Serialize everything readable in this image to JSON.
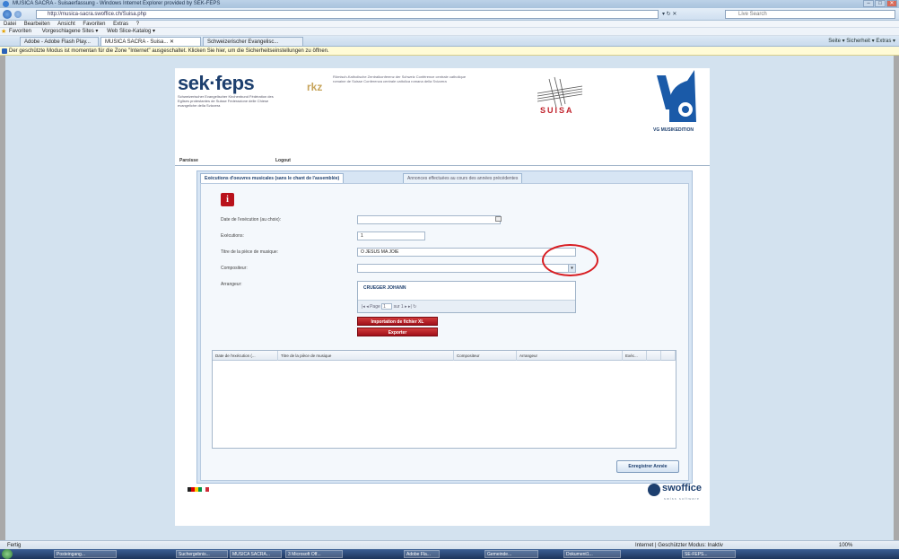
{
  "window": {
    "title": "MUSICA SACRA - Suisaerfassung - Windows Internet Explorer provided by SEK-FEPS",
    "min": "–",
    "max": "□",
    "close": "✕"
  },
  "address": {
    "url": "http://musica-sacra.swoffice.ch/Suisa.php",
    "controls": "▾ ↻ ✕",
    "search_placeholder": "Live Search"
  },
  "menu": [
    "Datei",
    "Bearbeiten",
    "Ansicht",
    "Favoriten",
    "Extras",
    "?"
  ],
  "favorites": {
    "label": "Favoriten",
    "items": [
      "Vorgeschlagene Sites ▾",
      "Web Slice-Katalog ▾"
    ]
  },
  "tabs": [
    "Adobe - Adobe Flash Play...",
    "MUSICA SACRA - Suisa... ✕",
    "Schweizerischer Evangelisc..."
  ],
  "toolbar_right": "Seite ▾  Sicherheit ▾  Extras ▾",
  "infobar": "Der geschützte Modus ist momentan für die Zone \"Internet\" ausgeschaltet. Klicken Sie hier, um die Sicherheitseinstellungen zu öffnen.",
  "header": {
    "logo": "sek·feps",
    "logo_sub": "Schweizerischer Evangelischer Kirchenbund Fédération des Eglises protestantes de Suisse Federazione delle Chiese evangeliche della Svizzera",
    "rkz": "rkz",
    "rkz_sub": "Römisch-Katholische Zentralkonferenz der Schweiz Conférence centrale catholique romaine de Suisse Conferenza centrale cattolica romana della Svizzera",
    "suisa": "SUISA",
    "vg": "VG MUSIKEDITION"
  },
  "pagenav": {
    "paroisse": "Paroisse",
    "logout": "Logout"
  },
  "panel_tabs": {
    "active": "Exécutions d'oeuvres musicales (sans le chant de l'assemblée)",
    "inactive": "Annonces effectuées au cours des années précédentes"
  },
  "form": {
    "info_icon": "i",
    "date_label": "Date de l'exécution (au choix):",
    "date_value": "",
    "executions_label": "Exécutions:",
    "executions_value": "1",
    "title_label": "Titre de la pièce de musique:",
    "title_value": "O JESUS MA JOIE",
    "composer_label": "Compositeur:",
    "composer_value": "",
    "arranger_label": "Arrangeur:",
    "dropdown_arrow": "▾"
  },
  "dropdown": {
    "option": "CRUEGER JOHANN",
    "pager_prefix": "|◂  ◂  Page",
    "page_value": "1",
    "pager_suffix": "sur 1   ▸  ▸|   ↻"
  },
  "buttons": {
    "import": "Importation de fichier XL",
    "export": "Exporter",
    "save": "Enregistrer Année"
  },
  "grid": {
    "columns": [
      "Date de l'exécution (...",
      "Titre de la pièce de musique",
      "Compositeur",
      "Arrangeur",
      "Exéc..."
    ]
  },
  "footer": {
    "swoffice": "swoffice",
    "swoffice_sub": "swiss software"
  },
  "status": {
    "ready": "Fertig",
    "zone": "Internet | Geschützter Modus: Inaktiv",
    "zoom": "100%"
  },
  "taskbar": [
    "Posteingang...",
    "Suchergebnis...",
    "MUSICA SACRA...",
    "3 Microsoft Off...",
    "Adobe Fla...",
    "Gemeinde...",
    "Dokument1...",
    "SE-FEPS..."
  ]
}
